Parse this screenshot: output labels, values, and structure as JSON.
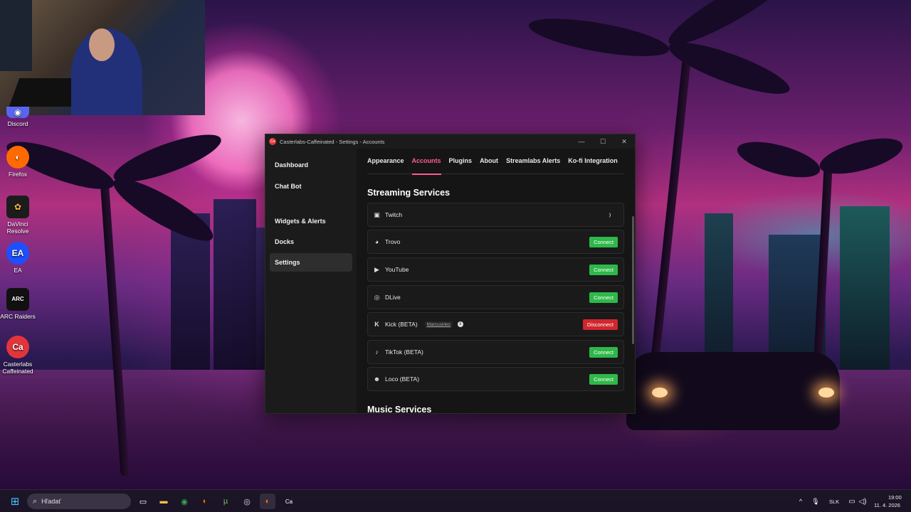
{
  "desktop": {
    "icons": [
      {
        "label": "Discord",
        "symbol": "◉",
        "color": "#5865f2"
      },
      {
        "label": "Firefox",
        "symbol": "◐",
        "color": "#ff6a00"
      },
      {
        "label": "DaVinci Resolve",
        "symbol": "✿",
        "color": "#1c1c1c"
      },
      {
        "label": "EA",
        "symbol": "EA",
        "color": "#1d4fff"
      },
      {
        "label": "ARC Raiders",
        "symbol": "ARC",
        "color": "#111111"
      },
      {
        "label": "Casterlabs Caffeinated",
        "symbol": "Ca",
        "color": "#e2353b"
      }
    ]
  },
  "window": {
    "title": "Casterlabs-Caffeinated - Settings - Accounts",
    "app_icon": "Ca",
    "controls": {
      "minimize": "—",
      "maximize": "☐",
      "close": "✕"
    }
  },
  "sidebar": {
    "items": [
      {
        "label": "Dashboard"
      },
      {
        "label": "Chat Bot"
      },
      {
        "label": "Widgets & Alerts"
      },
      {
        "label": "Docks"
      },
      {
        "label": "Settings"
      }
    ]
  },
  "tabs": [
    {
      "label": "Appearance"
    },
    {
      "label": "Accounts"
    },
    {
      "label": "Plugins"
    },
    {
      "label": "About"
    },
    {
      "label": "Streamlabs Alerts"
    },
    {
      "label": "Ko-fi Integration"
    }
  ],
  "sections": {
    "streaming_title": "Streaming Services",
    "music_title": "Music Services"
  },
  "services": [
    {
      "name": "Twitch",
      "icon": "▣",
      "state": "loading"
    },
    {
      "name": "Trovo",
      "icon": "◕",
      "state": "connect",
      "button": "Connect"
    },
    {
      "name": "YouTube",
      "icon": "▶",
      "state": "connect",
      "button": "Connect"
    },
    {
      "name": "DLive",
      "icon": "◎",
      "state": "connect",
      "button": "Connect"
    },
    {
      "name": "Kick (BETA)",
      "icon": "K",
      "state": "disconnect",
      "button": "Disconnect",
      "username": "Marcusinko",
      "info": "i"
    },
    {
      "name": "TikTok (BETA)",
      "icon": "♪",
      "state": "connect",
      "button": "Connect"
    },
    {
      "name": "Loco (BETA)",
      "icon": "☻",
      "state": "connect",
      "button": "Connect"
    }
  ],
  "taskbar": {
    "start_icon": "⊞",
    "search_placeholder": "Hľadať",
    "search_icon": "⌕",
    "apps": [
      {
        "name": "task-view",
        "symbol": "▭",
        "color": "#ffffff"
      },
      {
        "name": "file-explorer",
        "symbol": "▬",
        "color": "#f5c542"
      },
      {
        "name": "chrome",
        "symbol": "◉",
        "color": "#34a853"
      },
      {
        "name": "firefox",
        "symbol": "◐",
        "color": "#ff6a00"
      },
      {
        "name": "utorrent",
        "symbol": "µ",
        "color": "#6fbf4c"
      },
      {
        "name": "obs",
        "symbol": "◎",
        "color": "#dddddd"
      },
      {
        "name": "firefox-active",
        "symbol": "◐",
        "color": "#ff6a00"
      },
      {
        "name": "casterlabs",
        "symbol": "Ca",
        "color": "#e2353b"
      }
    ],
    "tray": {
      "chevron": "^",
      "mic": "🎙",
      "language": "SLK",
      "time": "19:00",
      "date": "11. 4. 2026"
    }
  }
}
